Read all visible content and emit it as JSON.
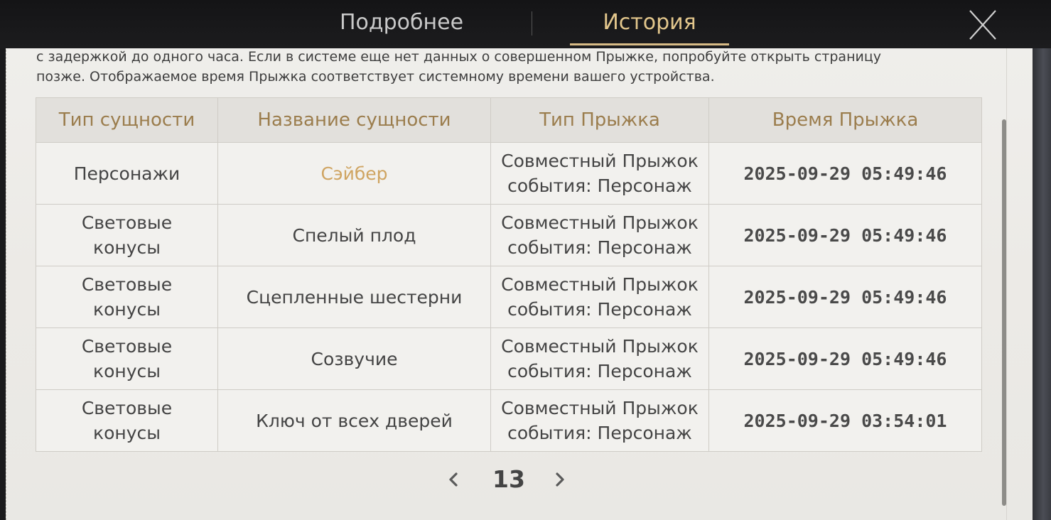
{
  "header": {
    "tabs": [
      {
        "label": "Подробнее",
        "active": false
      },
      {
        "label": "История",
        "active": true
      }
    ],
    "accent_color": "#e2c68c"
  },
  "notice": {
    "line1": "с задержкой до одного часа. Если в системе еще нет данных о совершенном Прыжке, попробуйте открыть страницу",
    "line2": "позже. Отображаемое время Прыжка соответствует системному времени вашего устройства."
  },
  "table": {
    "headers": [
      "Тип сущности",
      "Название сущности",
      "Тип Прыжка",
      "Время Прыжка"
    ],
    "rows": [
      {
        "type": [
          "Персонажи"
        ],
        "name": "Сэйбер",
        "highlight": true,
        "jump_type": [
          "Совместный Прыжок",
          "события: Персонаж"
        ],
        "time": "2025-09-29 05:49:46"
      },
      {
        "type": [
          "Световые",
          "конусы"
        ],
        "name": "Спелый плод",
        "highlight": false,
        "jump_type": [
          "Совместный Прыжок",
          "события: Персонаж"
        ],
        "time": "2025-09-29 05:49:46"
      },
      {
        "type": [
          "Световые",
          "конусы"
        ],
        "name": "Сцепленные шестерни",
        "highlight": false,
        "jump_type": [
          "Совместный Прыжок",
          "события: Персонаж"
        ],
        "time": "2025-09-29 05:49:46"
      },
      {
        "type": [
          "Световые",
          "конусы"
        ],
        "name": "Созвучие",
        "highlight": false,
        "jump_type": [
          "Совместный Прыжок",
          "события: Персонаж"
        ],
        "time": "2025-09-29 05:49:46"
      },
      {
        "type": [
          "Световые",
          "конусы"
        ],
        "name": "Ключ от всех дверей",
        "highlight": false,
        "jump_type": [
          "Совместный Прыжок",
          "события: Персонаж"
        ],
        "time": "2025-09-29 03:54:01"
      }
    ]
  },
  "pagination": {
    "page": "13",
    "prev_icon": "chevron-left-icon",
    "next_icon": "chevron-right-icon"
  },
  "icons": {
    "close": "close-icon"
  },
  "colors": {
    "highlight_name": "#cfa461",
    "header_text": "#9b7d4d"
  }
}
